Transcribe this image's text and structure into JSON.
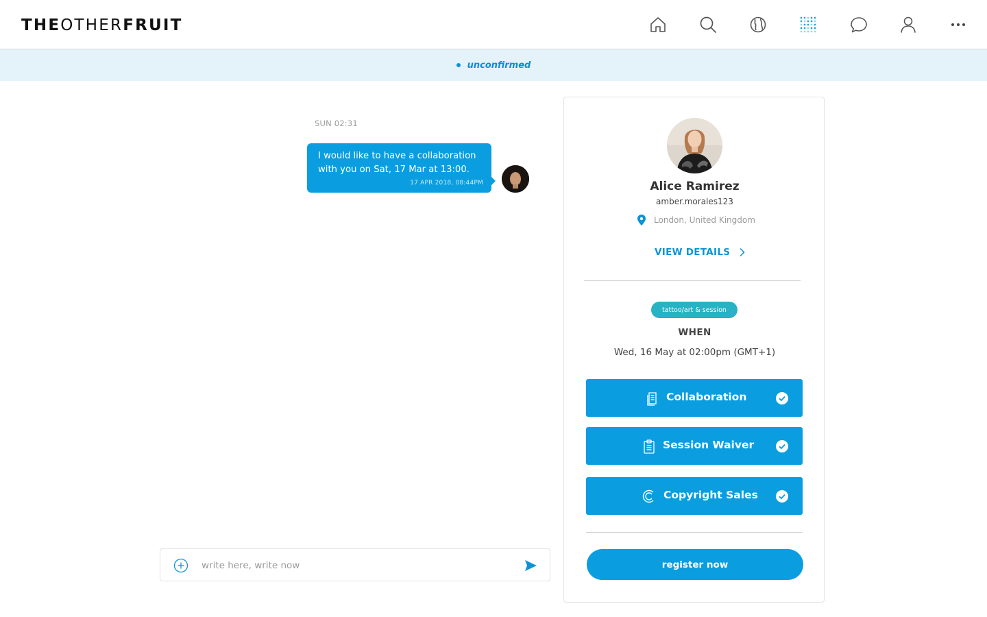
{
  "header": {
    "logo_bold_1": "THE",
    "logo_light": "OTHER",
    "logo_bold_2": "FRUIT",
    "nav_icons": [
      "home-icon",
      "search-icon",
      "globe-icon",
      "grid-dots-icon",
      "chat-icon",
      "user-icon",
      "more-icon"
    ],
    "active_nav": "grid-dots-icon"
  },
  "status": {
    "text": "unconfirmed"
  },
  "chat": {
    "day_time": "SUN 02:31",
    "messages": [
      {
        "text": "I would like to have a collaboration with you on Sat, 17 Mar at 13:00.",
        "timestamp": "17 APR 2018, 08:44PM"
      }
    ]
  },
  "composer": {
    "placeholder": "write here, write now"
  },
  "profile": {
    "name": "Alice Ramirez",
    "handle": "amber.morales123",
    "location": "London, United Kingdom",
    "view_details": "VIEW DETAILS",
    "tag": "tattoo/art & session",
    "when_label": "WHEN",
    "when_value": "Wed, 16 May at 02:00pm (GMT+1)",
    "documents": [
      {
        "label": "Collaboration",
        "icon": "document-icon",
        "checked": true
      },
      {
        "label": "Session Waiver",
        "icon": "clipboard-icon",
        "checked": true
      },
      {
        "label": "Copyright Sales",
        "icon": "copyright-icon",
        "checked": true
      }
    ],
    "register_label": "register now"
  },
  "colors": {
    "accent": "#0a9ee0",
    "status_bg": "#e4f2fa",
    "tag": "#27b3c3"
  }
}
